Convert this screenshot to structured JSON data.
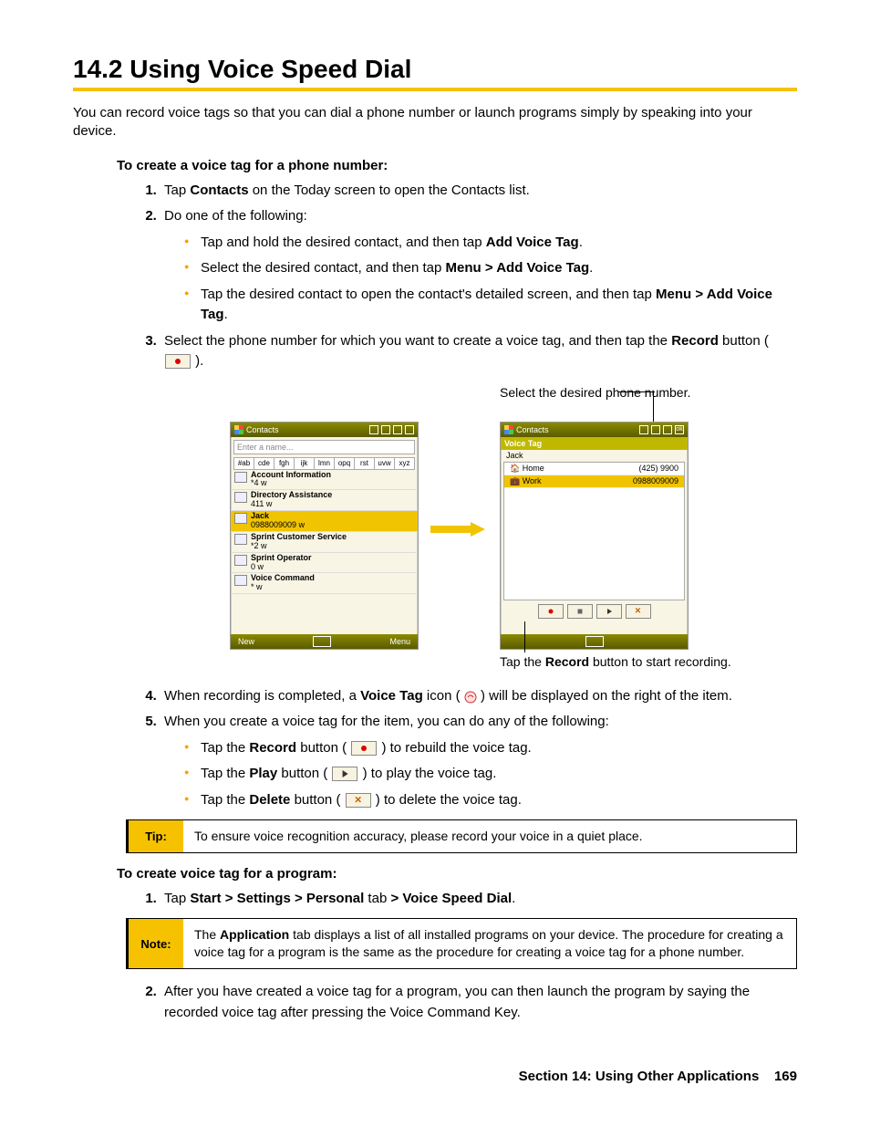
{
  "heading": "14.2  Using Voice Speed Dial",
  "intro": "You can record voice tags so that you can dial a phone number or launch programs simply by speaking into your device.",
  "sub1": "To create a voice tag for a phone number:",
  "steps1": {
    "s1_a": "Tap ",
    "s1_b": "Contacts",
    "s1_c": " on the Today screen to open the Contacts list.",
    "s2": "Do one of the following:",
    "b1_a": "Tap and hold the desired contact, and then tap ",
    "b1_b": "Add Voice Tag",
    "b1_c": ".",
    "b2_a": "Select the desired contact, and then tap ",
    "b2_b": "Menu > Add Voice Tag",
    "b2_c": ".",
    "b3_a": "Tap the desired contact to open the contact's detailed screen, and then tap ",
    "b3_b": "Menu > Add Voice Tag",
    "b3_c": ".",
    "s3_a": "Select the phone number for which you want to create a voice tag, and then tap the ",
    "s3_b": "Record",
    "s3_c": " button (",
    "s3_d": ")."
  },
  "callout_top": "Select the desired phone number.",
  "callout_bottom_a": "Tap the ",
  "callout_bottom_b": "Record",
  "callout_bottom_c": " button to start recording.",
  "phone_left": {
    "title": "Contacts",
    "input": "Enter a name...",
    "abc": [
      "#ab",
      "cde",
      "fgh",
      "ijk",
      "lmn",
      "opq",
      "rst",
      "uvw",
      "xyz"
    ],
    "rows": [
      {
        "name": "Account Information",
        "sub": "*4   w"
      },
      {
        "name": "Directory Assistance",
        "sub": "411   w"
      },
      {
        "name": "Jack",
        "sub": "0988009009   w",
        "sel": true
      },
      {
        "name": "Sprint Customer Service",
        "sub": "*2   w"
      },
      {
        "name": "Sprint Operator",
        "sub": "0   w"
      },
      {
        "name": "Voice Command",
        "sub": "*   w"
      }
    ],
    "footer_left": "New",
    "footer_right": "Menu"
  },
  "phone_right": {
    "title": "Contacts",
    "ok": "ok",
    "sub": "Voice Tag",
    "name": "Jack",
    "rows": [
      {
        "label": "Home",
        "value": "(425) 9900"
      },
      {
        "label": "Work",
        "value": "0988009009",
        "sel": true
      }
    ]
  },
  "steps2": {
    "s4_a": "When recording is completed, a ",
    "s4_b": "Voice Tag",
    "s4_c": " icon (",
    "s4_d": ") will be displayed on the right of the item.",
    "s5": "When you create a voice tag for the item, you can do any of the following:",
    "b1_a": "Tap the ",
    "b1_b": "Record",
    "b1_c": " button (",
    "b1_d": ") to rebuild the voice tag.",
    "b2_a": "Tap the ",
    "b2_b": "Play",
    "b2_c": " button (",
    "b2_d": ") to play the voice tag.",
    "b3_a": "Tap the ",
    "b3_b": "Delete",
    "b3_c": " button (",
    "b3_d": ") to delete the voice tag."
  },
  "tip_label": "Tip:",
  "tip_text": "To ensure voice recognition accuracy, please record your voice in a quiet place.",
  "sub2": "To create voice tag for a program:",
  "prog_s1_a": "Tap ",
  "prog_s1_b": "Start > Settings > Personal",
  "prog_s1_c": " tab ",
  "prog_s1_d": "> Voice Speed Dial",
  "prog_s1_e": ".",
  "note_label": "Note:",
  "note_a": "The ",
  "note_b": "Application",
  "note_c": " tab displays a list of all installed programs on your device. The procedure for creating a voice tag for a program is the same as the procedure for creating a voice tag for a phone number.",
  "prog_s2": "After you have created a voice tag for a program, you can then launch the program by saying the recorded voice tag after pressing the Voice  Command Key.",
  "footer_section": "Section 14: Using Other Applications",
  "footer_page": "169"
}
